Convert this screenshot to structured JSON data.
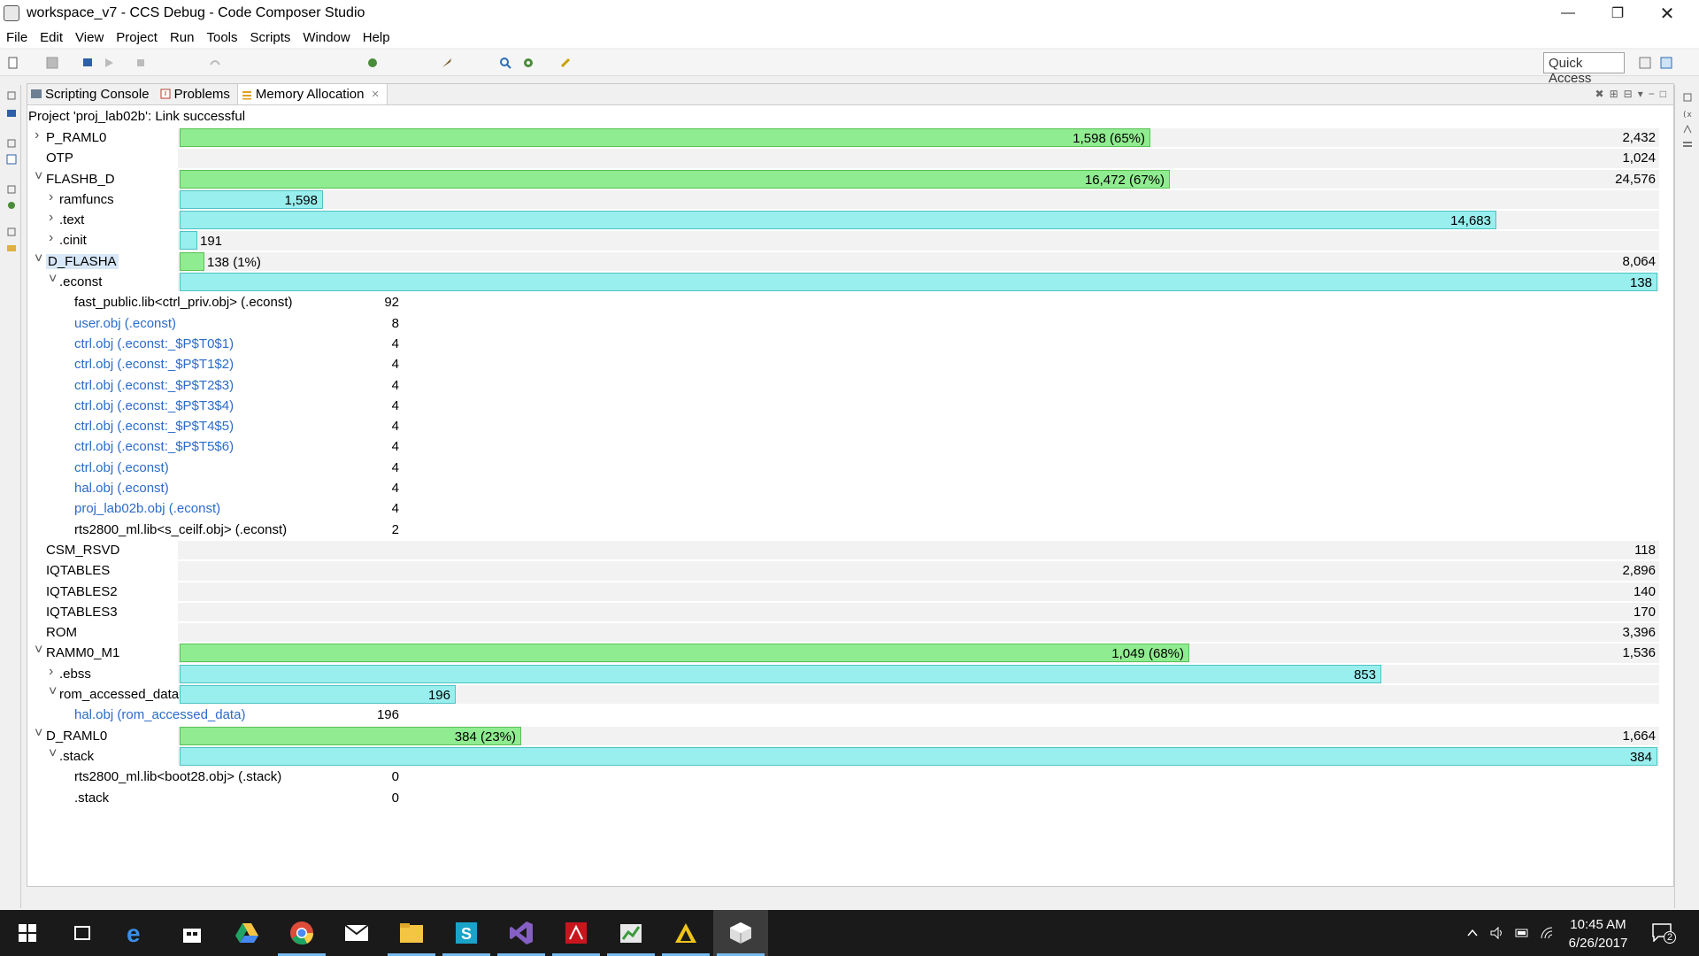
{
  "window": {
    "title": "workspace_v7 - CCS Debug - Code Composer Studio"
  },
  "menu": [
    "File",
    "Edit",
    "View",
    "Project",
    "Run",
    "Tools",
    "Scripts",
    "Window",
    "Help"
  ],
  "quick_access": "Quick Access",
  "tabs": [
    {
      "label": "Scripting Console",
      "icon": "console-icon",
      "active": false
    },
    {
      "label": "Problems",
      "icon": "problems-icon",
      "active": false
    },
    {
      "label": "Memory Allocation",
      "icon": "memory-icon",
      "active": true
    }
  ],
  "status": "Project 'proj_lab02b': Link successful",
  "memory_rows": [
    {
      "name": "P_RAML0",
      "level": 0,
      "toggle": "collapsed",
      "bar": "green",
      "bar_fraction": 0.657,
      "bar_label": "1,598 (65%)",
      "total": "2,432"
    },
    {
      "name": "OTP",
      "level": 0,
      "toggle": "none",
      "total": "1,024"
    },
    {
      "name": "FLASHB_D",
      "level": 0,
      "toggle": "expanded",
      "bar": "green",
      "bar_fraction": 0.67,
      "bar_label": "16,472 (67%)",
      "total": "24,576"
    },
    {
      "name": "ramfuncs",
      "level": 1,
      "toggle": "collapsed",
      "bar": "cyan",
      "bar_fraction": 0.097,
      "bar_label": "1,598"
    },
    {
      "name": ".text",
      "level": 1,
      "toggle": "collapsed",
      "bar": "cyan",
      "bar_fraction": 0.891,
      "bar_label": "14,683"
    },
    {
      "name": ".cinit",
      "level": 1,
      "toggle": "collapsed",
      "bar": "cyan",
      "bar_fraction": 0.012,
      "bar_label": "191",
      "label_outside": true
    },
    {
      "name": "D_FLASHA",
      "level": 0,
      "toggle": "expanded",
      "selected": true,
      "bar": "green",
      "bar_fraction": 0.017,
      "bar_label": "138 (1%)",
      "label_outside": true,
      "total": "8,064"
    },
    {
      "name": ".econst",
      "level": 1,
      "toggle": "expanded",
      "bar": "cyan",
      "bar_fraction": 1.0,
      "bar_label": "138"
    },
    {
      "name": "fast_public.lib<ctrl_priv.obj> (.econst)",
      "level": 2,
      "value": "92"
    },
    {
      "name": "user.obj (.econst)",
      "level": 2,
      "link": true,
      "value": "8"
    },
    {
      "name": "ctrl.obj (.econst:_$P$T0$1)",
      "level": 2,
      "link": true,
      "value": "4"
    },
    {
      "name": "ctrl.obj (.econst:_$P$T1$2)",
      "level": 2,
      "link": true,
      "value": "4"
    },
    {
      "name": "ctrl.obj (.econst:_$P$T2$3)",
      "level": 2,
      "link": true,
      "value": "4"
    },
    {
      "name": "ctrl.obj (.econst:_$P$T3$4)",
      "level": 2,
      "link": true,
      "value": "4"
    },
    {
      "name": "ctrl.obj (.econst:_$P$T4$5)",
      "level": 2,
      "link": true,
      "value": "4"
    },
    {
      "name": "ctrl.obj (.econst:_$P$T5$6)",
      "level": 2,
      "link": true,
      "value": "4"
    },
    {
      "name": "ctrl.obj (.econst)",
      "level": 2,
      "link": true,
      "value": "4"
    },
    {
      "name": "hal.obj (.econst)",
      "level": 2,
      "link": true,
      "value": "4"
    },
    {
      "name": "proj_lab02b.obj (.econst)",
      "level": 2,
      "link": true,
      "value": "4"
    },
    {
      "name": "rts2800_ml.lib<s_ceilf.obj> (.econst)",
      "level": 2,
      "value": "2"
    },
    {
      "name": "CSM_RSVD",
      "level": 0,
      "toggle": "none",
      "total": "118"
    },
    {
      "name": "IQTABLES",
      "level": 0,
      "toggle": "none",
      "total": "2,896"
    },
    {
      "name": "IQTABLES2",
      "level": 0,
      "toggle": "none",
      "total": "140"
    },
    {
      "name": "IQTABLES3",
      "level": 0,
      "toggle": "none",
      "total": "170"
    },
    {
      "name": "ROM",
      "level": 0,
      "toggle": "none",
      "total": "3,396"
    },
    {
      "name": "RAMM0_M1",
      "level": 0,
      "toggle": "expanded",
      "bar": "green",
      "bar_fraction": 0.683,
      "bar_label": "1,049 (68%)",
      "total": "1,536"
    },
    {
      "name": ".ebss",
      "level": 1,
      "toggle": "collapsed",
      "bar": "cyan",
      "bar_fraction": 0.813,
      "bar_label": "853"
    },
    {
      "name": "rom_accessed_data",
      "level": 1,
      "toggle": "expanded",
      "bar": "cyan",
      "bar_fraction": 0.187,
      "bar_label": "196"
    },
    {
      "name": "hal.obj (rom_accessed_data)",
      "level": 2,
      "link": true,
      "value": "196"
    },
    {
      "name": "D_RAML0",
      "level": 0,
      "toggle": "expanded",
      "bar": "green",
      "bar_fraction": 0.231,
      "bar_label": "384 (23%)",
      "total": "1,664"
    },
    {
      "name": ".stack",
      "level": 1,
      "toggle": "expanded",
      "bar": "cyan",
      "bar_fraction": 1.0,
      "bar_label": "384"
    },
    {
      "name": "rts2800_ml.lib<boot28.obj> (.stack)",
      "level": 2,
      "value": "0"
    },
    {
      "name": ".stack",
      "level": 2,
      "value": "0"
    }
  ],
  "colors": {
    "bar_green": "#90ec90",
    "bar_cyan": "#99eeee",
    "link": "#2c6bc9",
    "taskbar": "#1a1a1a"
  },
  "taskbar": {
    "apps": [
      "start-icon",
      "task-view-icon",
      "edge-icon",
      "store-icon",
      "google-drive-icon",
      "chrome-icon",
      "mail-icon",
      "file-explorer-icon",
      "simplicity-icon",
      "visual-studio-icon",
      "acrobat-icon",
      "spreadsheet-icon",
      "drive-sync-icon",
      "code-composer-icon"
    ],
    "time": "10:45 AM",
    "date": "6/26/2017",
    "notification_count": "2"
  }
}
